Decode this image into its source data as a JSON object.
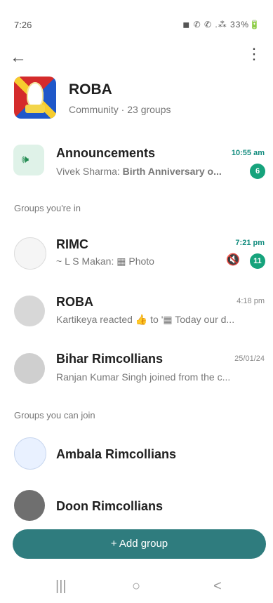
{
  "status_bar": {
    "time": "7:26",
    "icons_text": "◼ ✆ ✆ .⁂ 33%🔋"
  },
  "header": {
    "back_icon": "←",
    "menu_icon": "⋮"
  },
  "community": {
    "name": "ROBA",
    "subtitle": "Community · 23 groups"
  },
  "announcement": {
    "title": "Announcements",
    "sender": "Vivek Sharma:",
    "preview": "Birth Anniversary o...",
    "time": "10:55 am",
    "badge": "6",
    "icon": "megaphone-icon"
  },
  "sections": {
    "groups_in": "Groups you're in",
    "groups_join": "Groups you can join"
  },
  "groups_in": [
    {
      "name": "RIMC",
      "preview": "~ L S Makan: ▦ Photo",
      "time": "7:21 pm",
      "badge": "11",
      "muted_icon": "🔇"
    },
    {
      "name": "ROBA",
      "preview": "Kartikeya reacted 👍 to '▦ Today our d...",
      "time": "4:18 pm"
    },
    {
      "name": "Bihar Rimcollians",
      "preview": "Ranjan Kumar Singh joined from the c...",
      "time": "25/01/24"
    }
  ],
  "groups_join": [
    {
      "name": "Ambala Rimcollians"
    },
    {
      "name": "Doon Rimcollians"
    }
  ],
  "bottom_button": {
    "label": "+   Add group"
  },
  "nav": {
    "recent": "|||",
    "home": "○",
    "back": "<"
  }
}
